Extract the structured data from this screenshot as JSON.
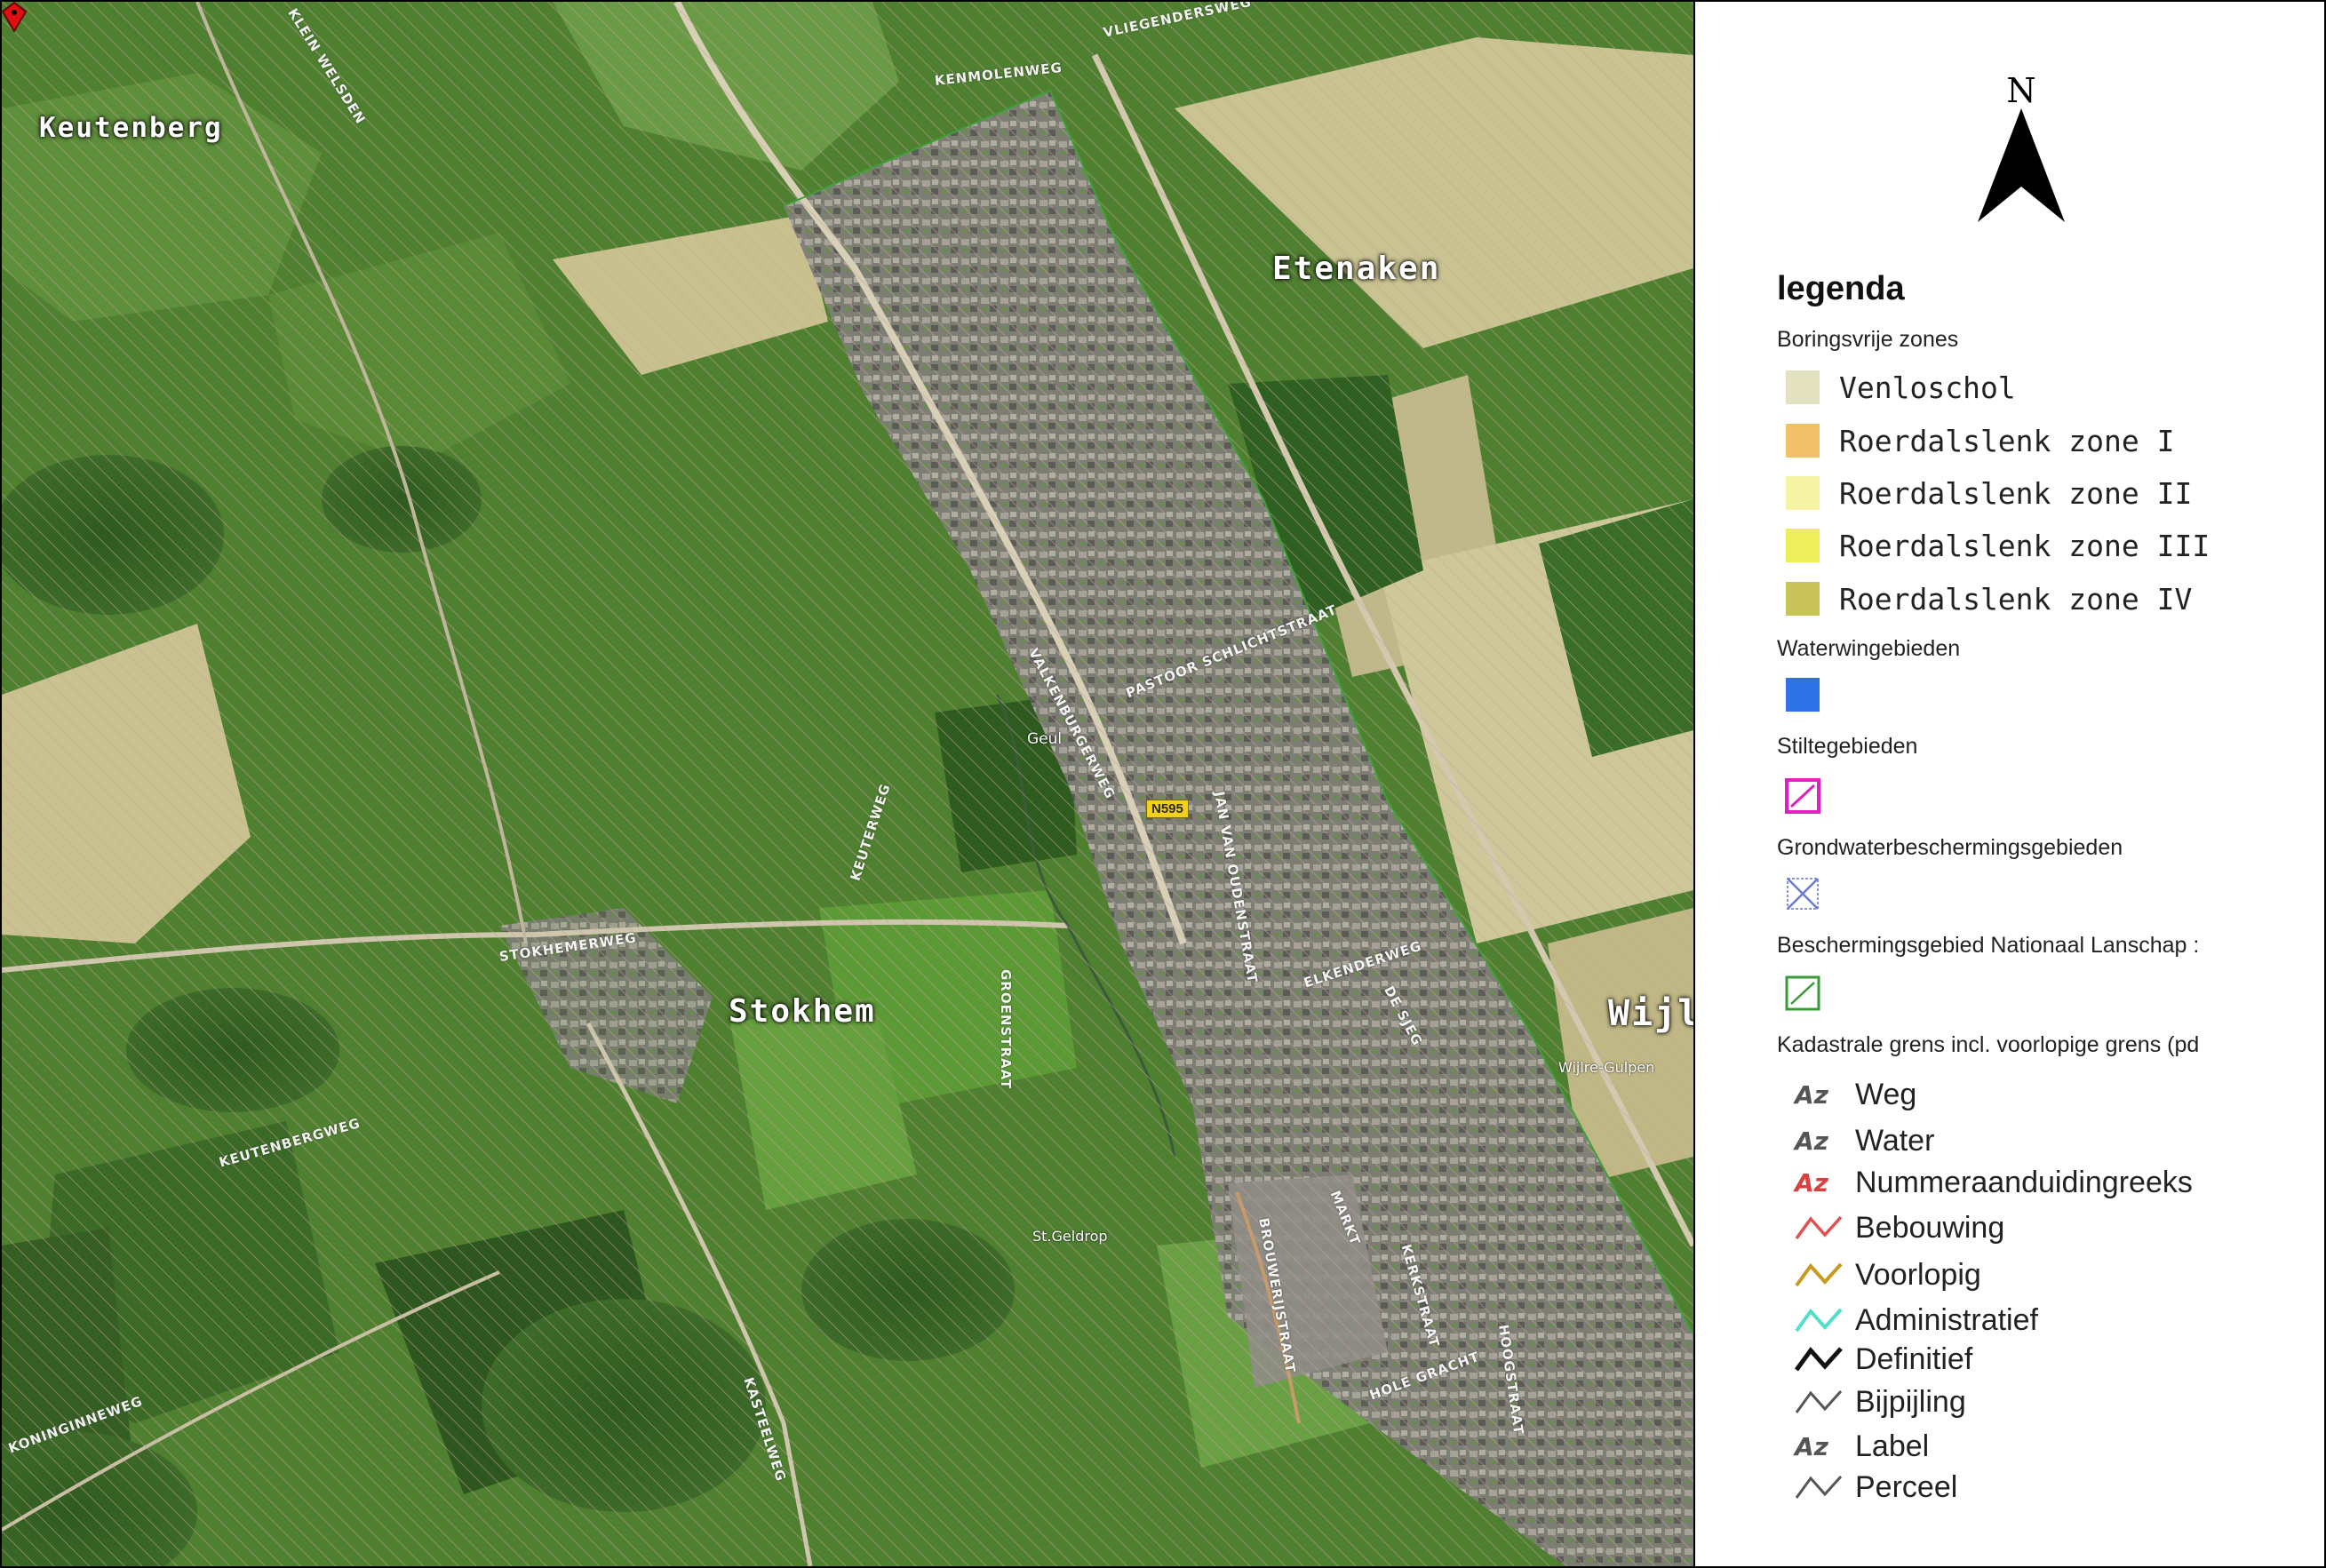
{
  "map": {
    "places": {
      "keutenberg": "Keutenberg",
      "etenaken": "Etenaken",
      "stokhem": "Stokhem",
      "wijl": "Wijl"
    },
    "streets": [
      "KLEIN WELSDEN",
      "STOKHEMERWEG",
      "KEUTENBERGWEG",
      "KENMOLENWEG",
      "VALKENBURGERWEG",
      "PASTOOR SCHLICHTSTRAAT",
      "JAN VAN OUDENSTRAAT",
      "ELKENDERWEG",
      "DE SJEG",
      "BROUWERIJSTRAAT",
      "MARKT",
      "HOOGSTRAAT",
      "HOLE GRACHT",
      "KERKSTRAAT",
      "KASTEELWEG",
      "KEUTERWEG",
      "GROENSTRAAT",
      "VLIEGENDERSWEG",
      "KONINGINNEWEG"
    ],
    "labels": {
      "geul": "Geul",
      "road_number": "N595",
      "wijlre_gulpen": "Wijlre-Gulpen",
      "st_geldrop": "St.Geldrop"
    },
    "colors": {
      "terrain": "#4a7a2c",
      "hatch": "#c89a9a",
      "village": "#8a8a85",
      "marker": "#e01010"
    }
  },
  "legend": {
    "north_letter": "N",
    "title": "legenda",
    "boringsvrije": {
      "heading": "Boringsvrije zones",
      "items": [
        {
          "label": "Venloschol",
          "color": "#e2e2c0"
        },
        {
          "label": "Roerdalslenk zone I",
          "color": "#f2c06a"
        },
        {
          "label": "Roerdalslenk zone II",
          "color": "#f4f4a4"
        },
        {
          "label": "Roerdalslenk zone III",
          "color": "#eeee5a"
        },
        {
          "label": "Roerdalslenk zone IV",
          "color": "#c8c45a"
        }
      ]
    },
    "waterwingebieden": {
      "heading": "Waterwingebieden",
      "color": "#2f72e8"
    },
    "stiltegebieden": {
      "heading": "Stiltegebieden",
      "color": "#e020c0"
    },
    "grondwater": {
      "heading": "Grondwaterbeschermingsgebieden",
      "color": "#6a7ad0"
    },
    "nationaal_landschap": {
      "heading": "Beschermingsgebied Nationaal Lanschap :",
      "color": "#3a9a3a"
    },
    "kadastrale": {
      "heading": "Kadastrale grens incl. voorlopige grens (pd",
      "items": [
        {
          "label": "Weg",
          "icon": "az-icon",
          "color": "#555555"
        },
        {
          "label": "Water",
          "icon": "az-icon",
          "color": "#555555"
        },
        {
          "label": "Nummeraanduidingreeks",
          "icon": "az-icon",
          "color": "#d94040"
        },
        {
          "label": "Bebouwing",
          "icon": "line-icon",
          "color": "#e05050"
        },
        {
          "label": "Voorlopig",
          "icon": "line-icon",
          "color": "#c89a20"
        },
        {
          "label": "Administratief",
          "icon": "line-icon",
          "color": "#50e0c8"
        },
        {
          "label": "Definitief",
          "icon": "line-icon",
          "color": "#111111"
        },
        {
          "label": "Bijpijling",
          "icon": "line-icon",
          "color": "#555555"
        },
        {
          "label": "Label",
          "icon": "az-icon",
          "color": "#555555"
        },
        {
          "label": "Perceel",
          "icon": "line-icon",
          "color": "#555555"
        }
      ]
    }
  }
}
